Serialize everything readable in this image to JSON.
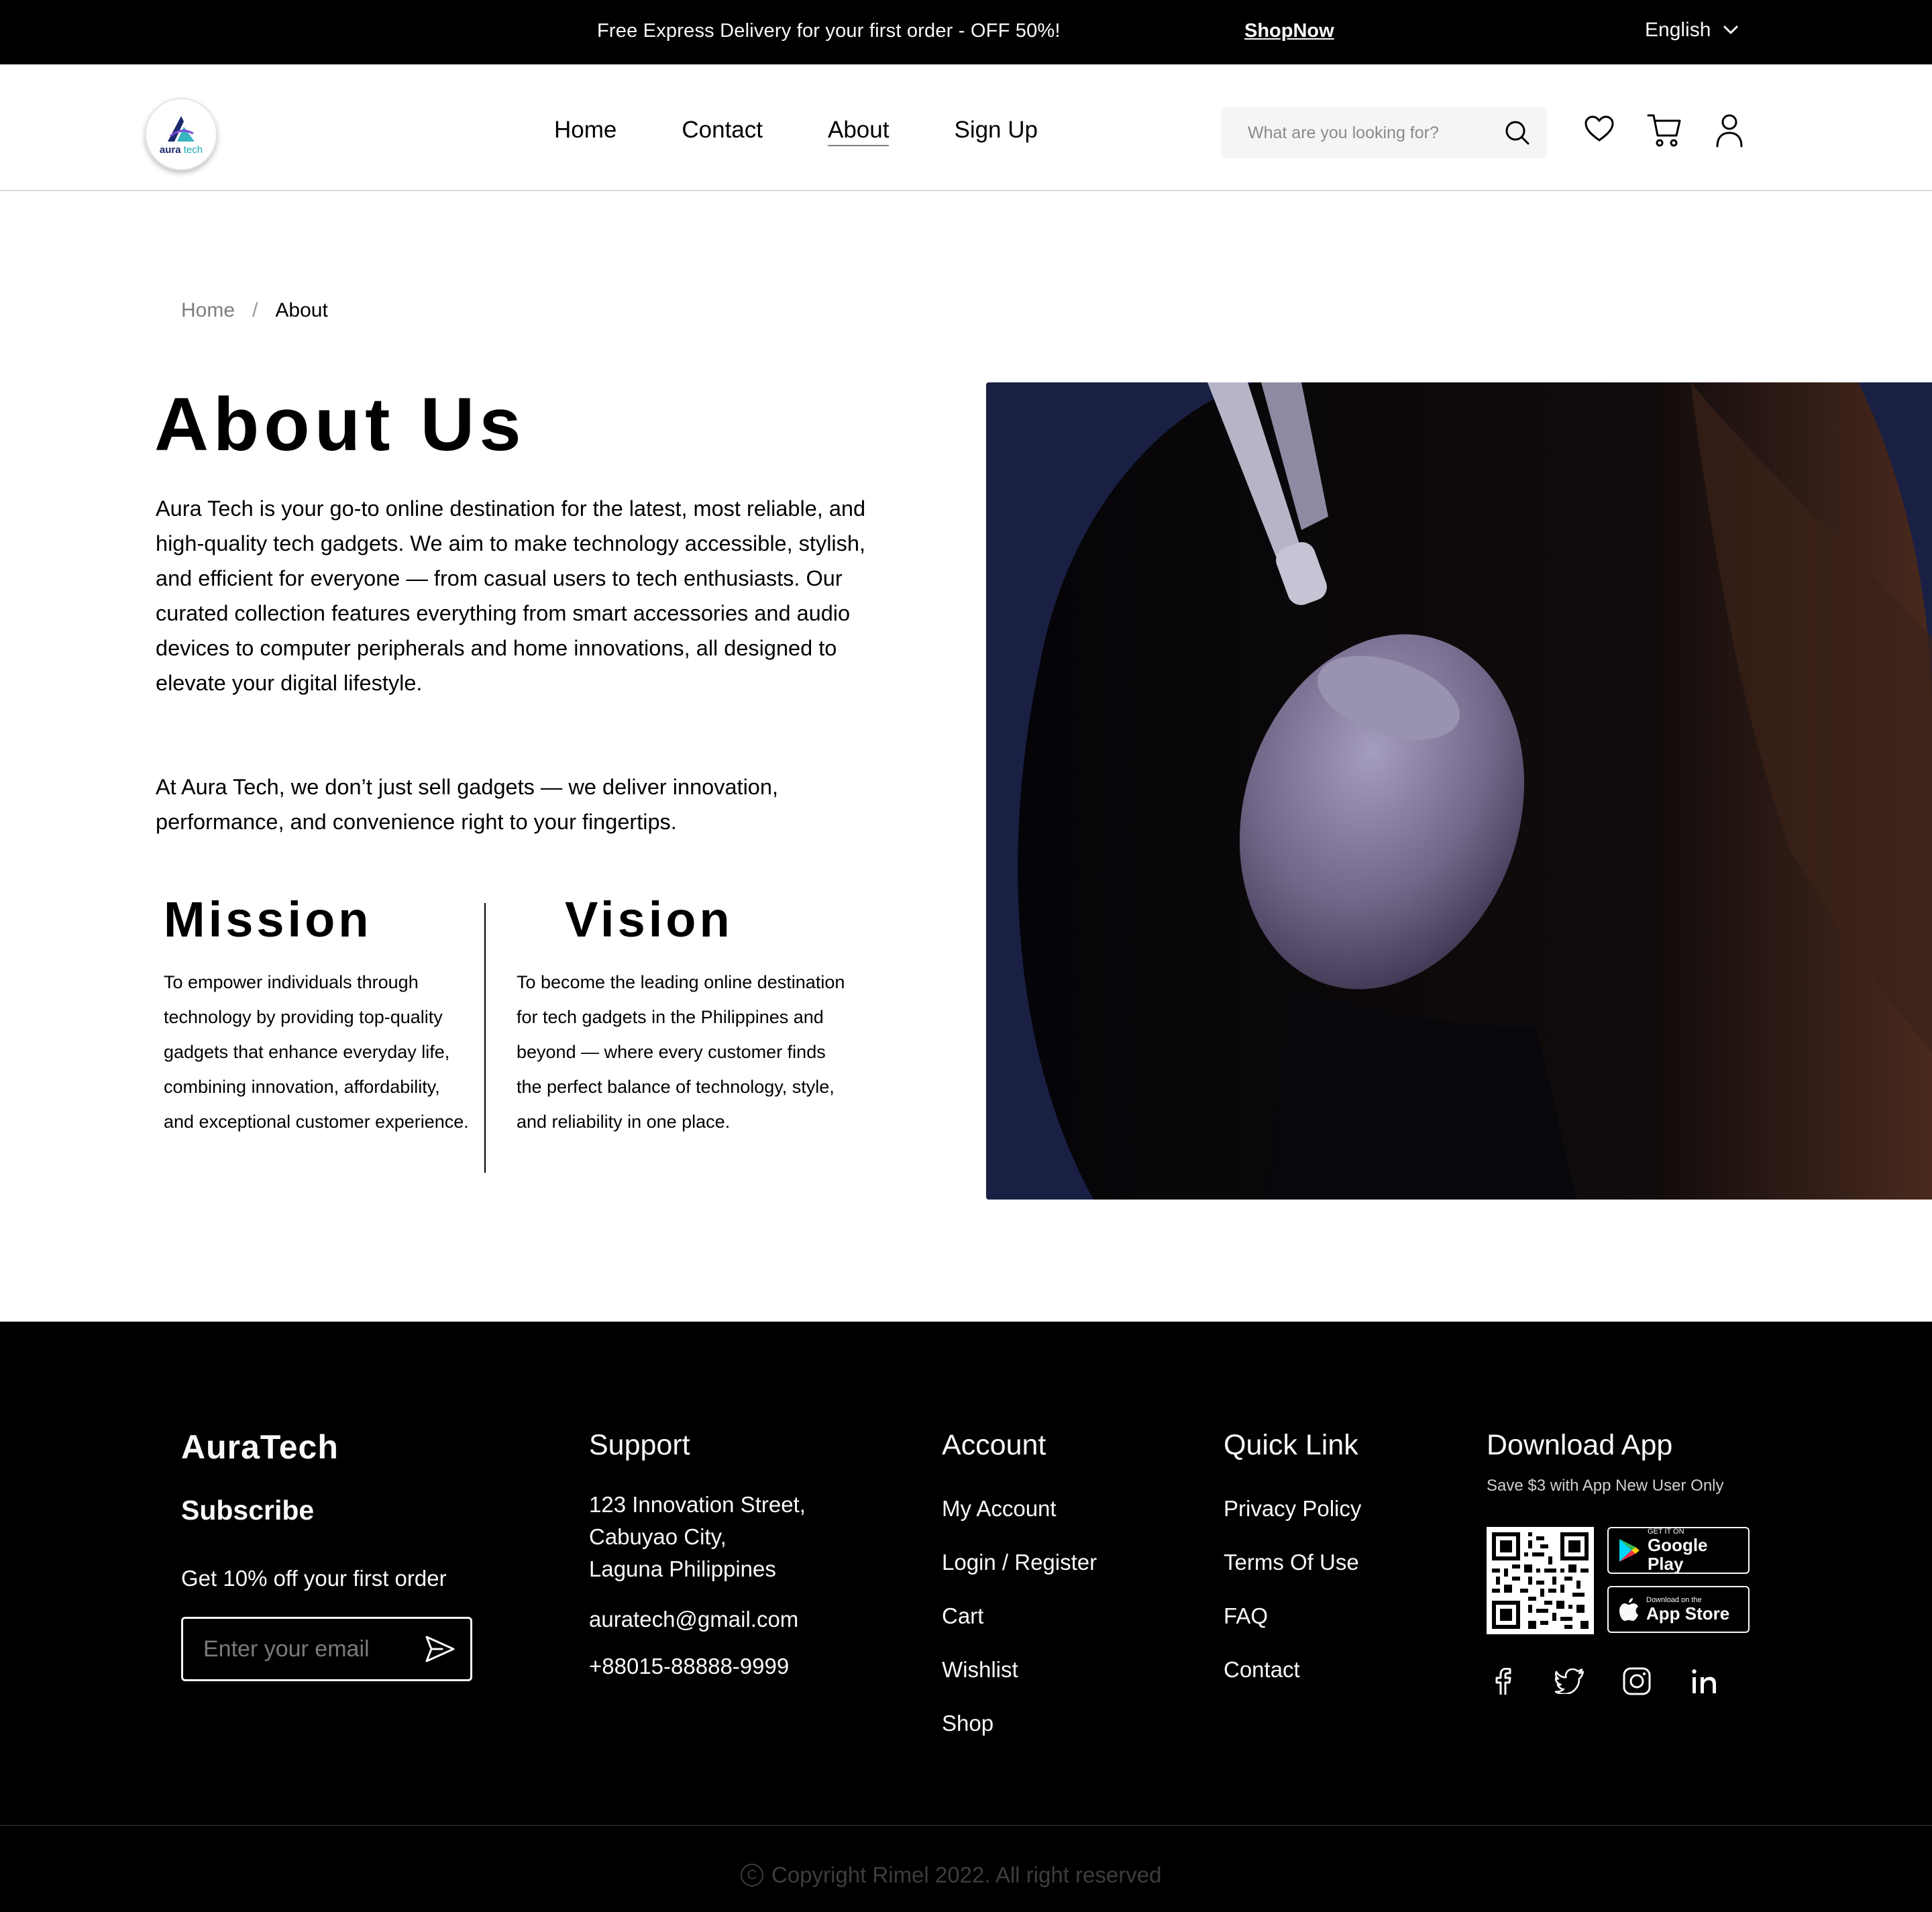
{
  "topbar": {
    "promo": "Free Express Delivery for your first order - OFF 50%!",
    "shop_now": "ShopNow",
    "language": "English"
  },
  "header": {
    "logo_text_main": "aura",
    "logo_text_accent": "tech",
    "nav": [
      "Home",
      "Contact",
      "About",
      "Sign Up"
    ],
    "active_nav": "About",
    "search_placeholder": "What are you looking for?"
  },
  "breadcrumb": {
    "home": "Home",
    "separator": "/",
    "current": "About"
  },
  "about": {
    "title": "About Us",
    "paragraph1": "Aura Tech is your go-to online destination for the latest, most reliable, and high-quality tech gadgets. We aim to make technology accessible, stylish, and efficient for everyone — from casual users to tech enthusiasts. Our curated collection features everything from smart accessories and audio devices to computer peripherals and home innovations, all designed to elevate your digital lifestyle.",
    "paragraph2": "At Aura Tech, we don’t just sell gadgets — we deliver innovation, performance, and convenience right to your fingertips.",
    "mission_title": "Mission",
    "mission_text": "To empower individuals through technology by providing top-quality gadgets that enhance everyday life, combining innovation, affordability, and exceptional customer experience.",
    "vision_title": "Vision",
    "vision_text": "To become the leading online destination for tech gadgets in the Philippines and beyond — where every customer finds the perfect balance of technology, style, and reliability in one place."
  },
  "footer": {
    "brand": "AuraTech",
    "subscribe": "Subscribe",
    "offer": "Get 10% off your first order",
    "email_placeholder": "Enter your email",
    "support": {
      "title": "Support",
      "address": [
        "123 Innovation Street,",
        "Cabuyao City,",
        "Laguna Philippines"
      ],
      "email": "auratech@gmail.com",
      "phone": "+88015-88888-9999"
    },
    "account": {
      "title": "Account",
      "links": [
        "My Account",
        "Login / Register",
        "Cart",
        "Wishlist",
        "Shop"
      ]
    },
    "quick_link": {
      "title": "Quick Link",
      "links": [
        "Privacy Policy",
        "Terms Of Use",
        "FAQ",
        "Contact"
      ]
    },
    "download": {
      "title": "Download App",
      "save_text": "Save $3 with App New User Only",
      "google_small": "GET IT ON",
      "google_big": "Google Play",
      "apple_small": "Download on the",
      "apple_big": "App Store"
    },
    "socials": [
      "facebook-icon",
      "twitter-icon",
      "instagram-icon",
      "linkedin-icon"
    ],
    "copyright": "Copyright Rimel 2022. All right reserved"
  },
  "colors": {
    "topbar_bg": "#000000",
    "footer_bg": "#000000",
    "hero_bg": "#1a1f44",
    "search_bg": "#f5f5f5"
  }
}
